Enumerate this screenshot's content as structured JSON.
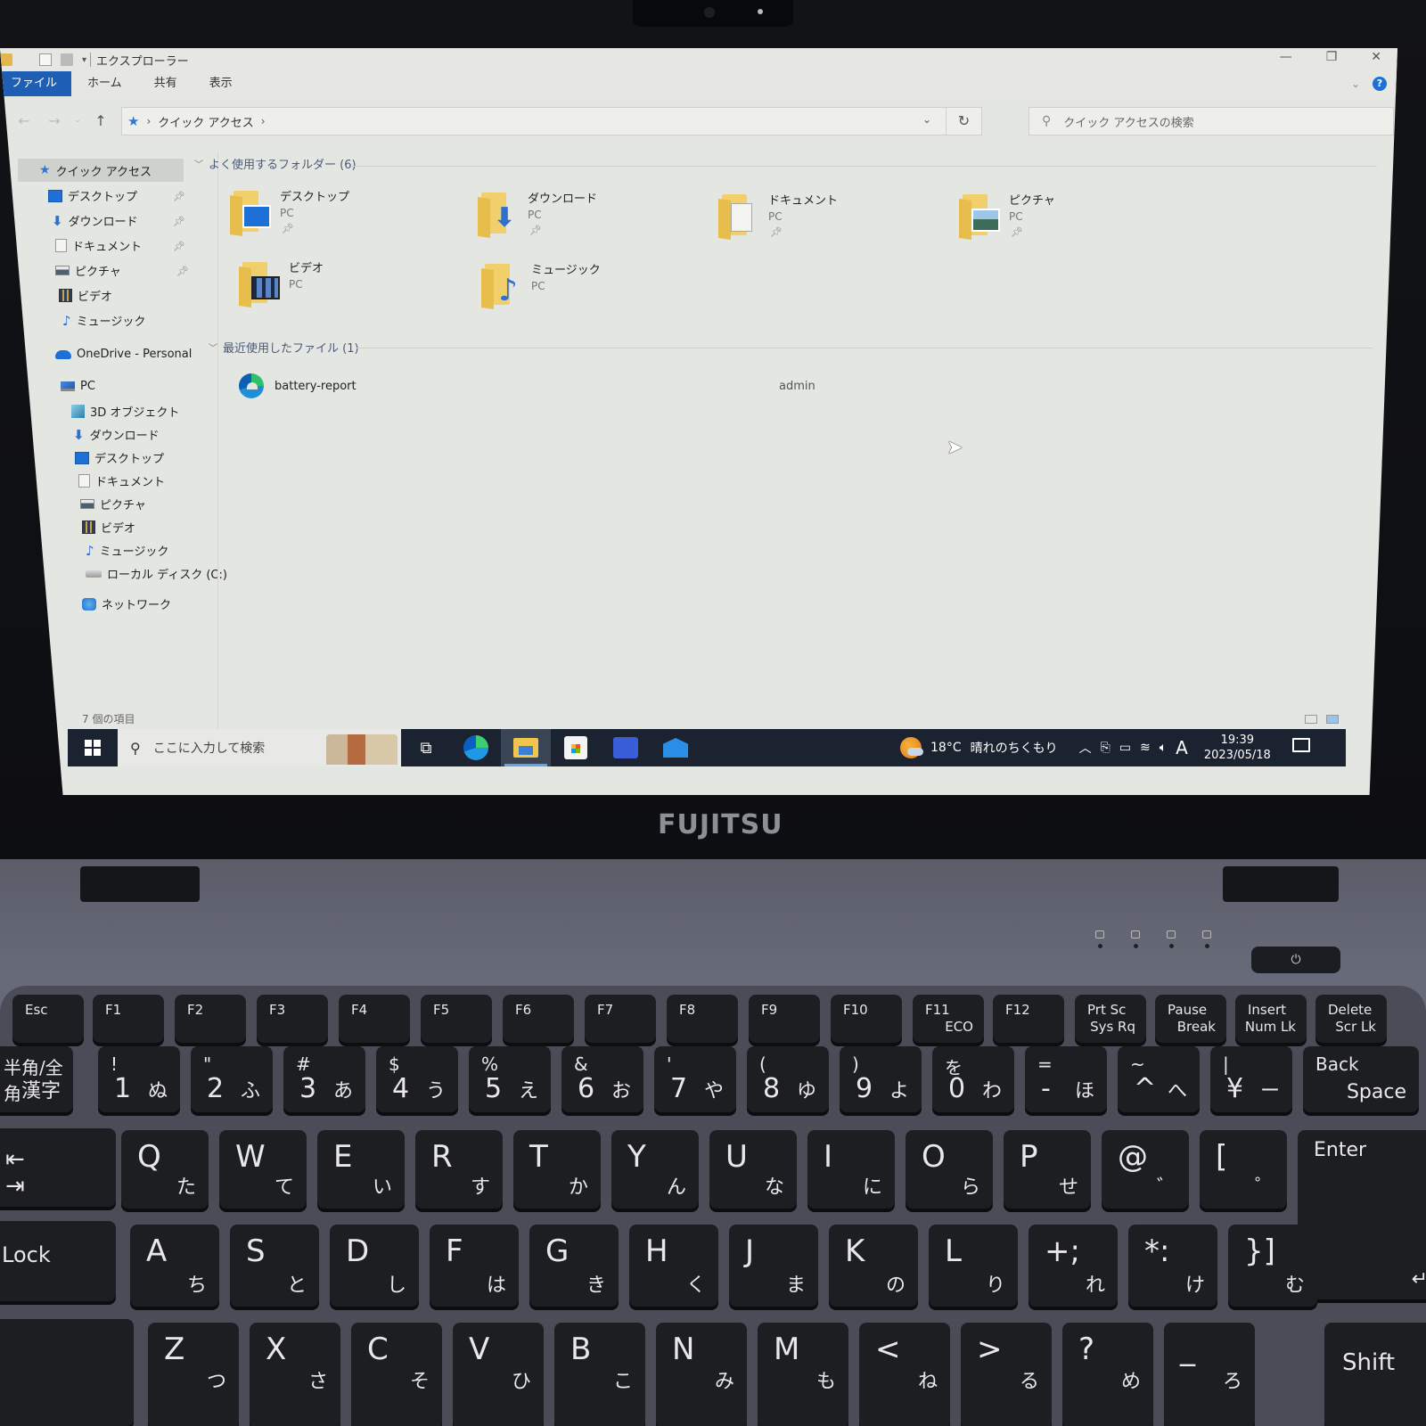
{
  "window": {
    "title": "エクスプローラー",
    "controls": {
      "minimize": "—",
      "restore": "❐",
      "close": "✕"
    }
  },
  "ribbon": {
    "tabs": [
      "ファイル",
      "ホーム",
      "共有",
      "表示"
    ],
    "help": "?"
  },
  "navigation": {
    "back": "←",
    "forward": "→",
    "up": "↑",
    "breadcrumb": [
      "クイック アクセス"
    ],
    "search_placeholder": "クイック アクセスの検索"
  },
  "nav_pane": {
    "quick_access": {
      "label": "クイック アクセス",
      "items": [
        {
          "label": "デスクトップ",
          "icon": "desktop-icon",
          "pinned": true
        },
        {
          "label": "ダウンロード",
          "icon": "download-icon",
          "pinned": true
        },
        {
          "label": "ドキュメント",
          "icon": "document-icon",
          "pinned": true
        },
        {
          "label": "ピクチャ",
          "icon": "picture-icon",
          "pinned": true
        },
        {
          "label": "ビデオ",
          "icon": "video-icon",
          "pinned": false
        },
        {
          "label": "ミュージック",
          "icon": "music-icon",
          "pinned": false
        }
      ]
    },
    "onedrive": "OneDrive - Personal",
    "pc": {
      "label": "PC",
      "items": [
        {
          "label": "3D オブジェクト",
          "icon": "3d-objects-icon"
        },
        {
          "label": "ダウンロード",
          "icon": "download-icon"
        },
        {
          "label": "デスクトップ",
          "icon": "desktop-icon"
        },
        {
          "label": "ドキュメント",
          "icon": "document-icon"
        },
        {
          "label": "ピクチャ",
          "icon": "picture-icon"
        },
        {
          "label": "ビデオ",
          "icon": "video-icon"
        },
        {
          "label": "ミュージック",
          "icon": "music-icon"
        },
        {
          "label": "ローカル ディスク (C:)",
          "icon": "local-disk-icon"
        }
      ]
    },
    "network": "ネットワーク"
  },
  "content": {
    "frequent_header": "よく使用するフォルダー (6)",
    "folders": [
      {
        "name": "デスクトップ",
        "location": "PC",
        "pinned": true,
        "badge": "desktop"
      },
      {
        "name": "ダウンロード",
        "location": "PC",
        "pinned": true,
        "badge": "download"
      },
      {
        "name": "ドキュメント",
        "location": "PC",
        "pinned": true,
        "badge": "doc"
      },
      {
        "name": "ピクチャ",
        "location": "PC",
        "pinned": true,
        "badge": "pic"
      },
      {
        "name": "ビデオ",
        "location": "PC",
        "pinned": false,
        "badge": "video"
      },
      {
        "name": "ミュージック",
        "location": "PC",
        "pinned": false,
        "badge": "music"
      }
    ],
    "recent_header": "最近使用したファイル (1)",
    "recent_files": [
      {
        "name": "battery-report",
        "owner": "admin"
      }
    ],
    "status": "7 個の項目"
  },
  "taskbar": {
    "search_placeholder": "ここに入力して検索",
    "apps": [
      "task-view",
      "edge",
      "file-explorer",
      "microsoft-store",
      "settings",
      "mail"
    ],
    "active_app": "file-explorer",
    "weather": {
      "temp": "18°C",
      "condition": "晴れのちくもり"
    },
    "ime": "A",
    "time": "19:39",
    "date": "2023/05/18"
  },
  "hardware": {
    "brand": "FUJITSU",
    "function_keys": [
      "Esc",
      "F1",
      "F2",
      "F3",
      "F4",
      "F5",
      "F6",
      "F7",
      "F8",
      "F9",
      "F10",
      "F11",
      "F12",
      "Prt Sc",
      "Pause",
      "Insert",
      "Delete"
    ],
    "function_sub": [
      "",
      "",
      "",
      "",
      "",
      "",
      "",
      "",
      "",
      "",
      "",
      "ECO",
      "",
      "Sys Rq",
      "Break",
      "Num Lk",
      "Scr Lk"
    ],
    "number_row": [
      {
        "top": "半角/全角",
        "main": "",
        "kana": "漢字"
      },
      {
        "top": "!",
        "main": "1",
        "kana": "ぬ"
      },
      {
        "top": "\"",
        "main": "2",
        "kana": "ふ"
      },
      {
        "top": "#",
        "main": "3",
        "kana": "あ"
      },
      {
        "top": "$",
        "main": "4",
        "kana": "う"
      },
      {
        "top": "%",
        "main": "5",
        "kana": "え"
      },
      {
        "top": "&",
        "main": "6",
        "kana": "お"
      },
      {
        "top": "'",
        "main": "7",
        "kana": "や"
      },
      {
        "top": "(",
        "main": "8",
        "kana": "ゆ"
      },
      {
        "top": ")",
        "main": "9",
        "kana": "よ"
      },
      {
        "top": "を",
        "main": "0",
        "kana": "わ"
      },
      {
        "top": "=",
        "main": "-",
        "kana": "ほ"
      },
      {
        "top": "~",
        "main": "^",
        "kana": "へ"
      },
      {
        "top": "|",
        "main": "¥",
        "kana": "ー"
      },
      {
        "top": "Back",
        "main": "",
        "kana": "Space"
      }
    ],
    "qwerty_row": [
      {
        "main": "Q",
        "kana": "た"
      },
      {
        "main": "W",
        "kana": "て"
      },
      {
        "main": "E",
        "kana": "い"
      },
      {
        "main": "R",
        "kana": "す"
      },
      {
        "main": "T",
        "kana": "か"
      },
      {
        "main": "Y",
        "kana": "ん"
      },
      {
        "main": "U",
        "kana": "な"
      },
      {
        "main": "I",
        "kana": "に"
      },
      {
        "main": "O",
        "kana": "ら"
      },
      {
        "main": "P",
        "kana": "せ"
      },
      {
        "main": "@",
        "kana": "゛"
      },
      {
        "main": "[",
        "kana": "゜"
      },
      {
        "main": "Enter",
        "kana": "↵"
      }
    ],
    "asdf_row": [
      {
        "main": "A",
        "kana": "ち"
      },
      {
        "main": "S",
        "kana": "と"
      },
      {
        "main": "D",
        "kana": "し"
      },
      {
        "main": "F",
        "kana": "は"
      },
      {
        "main": "G",
        "kana": "き"
      },
      {
        "main": "H",
        "kana": "く"
      },
      {
        "main": "J",
        "kana": "ま"
      },
      {
        "main": "K",
        "kana": "の"
      },
      {
        "main": "L",
        "kana": "り"
      },
      {
        "main": "+;",
        "kana": "れ"
      },
      {
        "main": "*:",
        "kana": "け"
      },
      {
        "main": "}]",
        "kana": "む"
      }
    ],
    "zxcv_row": [
      {
        "main": "Z",
        "kana": "つ"
      },
      {
        "main": "X",
        "kana": "さ"
      },
      {
        "main": "C",
        "kana": "そ"
      },
      {
        "main": "V",
        "kana": "ひ"
      },
      {
        "main": "B",
        "kana": "こ"
      },
      {
        "main": "N",
        "kana": "み"
      },
      {
        "main": "M",
        "kana": "も"
      },
      {
        "main": "<",
        "kana": "ね"
      },
      {
        "main": ">",
        "kana": "る"
      },
      {
        "main": "?",
        "kana": "め"
      },
      {
        "main": "_",
        "kana": "ろ"
      }
    ],
    "caps_label": "Lock",
    "shift_label": "Shift",
    "power": "⏻"
  }
}
